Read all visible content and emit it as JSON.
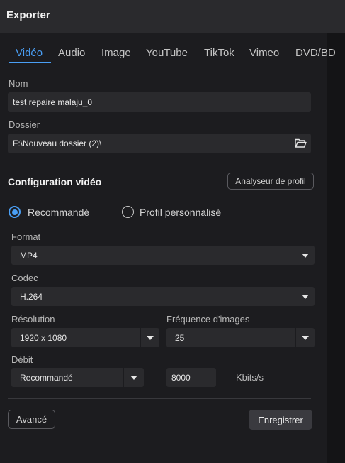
{
  "window": {
    "title": "Exporter"
  },
  "tabs": [
    {
      "label": "Vidéo",
      "active": true
    },
    {
      "label": "Audio",
      "active": false
    },
    {
      "label": "Image",
      "active": false
    },
    {
      "label": "YouTube",
      "active": false
    },
    {
      "label": "TikTok",
      "active": false
    },
    {
      "label": "Vimeo",
      "active": false
    },
    {
      "label": "DVD/BD",
      "active": false
    }
  ],
  "name": {
    "label": "Nom",
    "value": "test repaire malaju_0"
  },
  "folder": {
    "label": "Dossier",
    "value": "F:\\Nouveau dossier (2)\\",
    "icon": "folder-open-icon"
  },
  "video_config": {
    "heading": "Configuration vidéo",
    "profile_analyzer_label": "Analyseur de profil",
    "options": [
      {
        "label": "Recommandé",
        "checked": true
      },
      {
        "label": "Profil personnalisé",
        "checked": false
      }
    ]
  },
  "format": {
    "label": "Format",
    "value": "MP4"
  },
  "codec": {
    "label": "Codec",
    "value": "H.264"
  },
  "resolution": {
    "label": "Résolution",
    "value": "1920 x 1080"
  },
  "framerate": {
    "label": "Fréquence d'images",
    "value": "25"
  },
  "bitrate": {
    "label": "Débit",
    "value": "Recommandé",
    "amount": "8000",
    "unit": "Kbits/s"
  },
  "footer": {
    "advanced_label": "Avancé",
    "save_label": "Enregistrer"
  },
  "colors": {
    "accent": "#4a9ff5",
    "background": "#1c1c1f",
    "field": "#2a2a2d"
  }
}
